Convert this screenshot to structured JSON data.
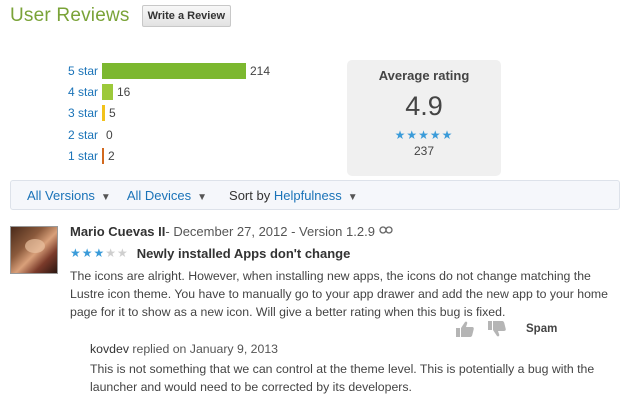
{
  "header": {
    "title": "User Reviews",
    "write_label": "Write a Review"
  },
  "histogram": [
    {
      "label": "5 star",
      "count": "214",
      "value": 214,
      "color": "#7cb82f"
    },
    {
      "label": "4 star",
      "count": "16",
      "value": 16,
      "color": "#9cc93a"
    },
    {
      "label": "3 star",
      "count": "5",
      "value": 5,
      "color": "#f2c21b"
    },
    {
      "label": "2 star",
      "count": "0",
      "value": 0,
      "color": "#f0a020"
    },
    {
      "label": "1 star",
      "count": "2",
      "value": 2,
      "color": "#d2691e"
    }
  ],
  "average": {
    "title": "Average rating",
    "value": "4.9",
    "stars": "★★★★★",
    "count": "237"
  },
  "filters": {
    "versions": "All Versions",
    "devices": "All Devices",
    "sort_prefix": "Sort by",
    "sort_value": "Helpfulness"
  },
  "review": {
    "author": "Mario Cuevas II",
    "meta": " - December 27, 2012 - Version 1.2.9",
    "stars_on": "★★★",
    "stars_off": "★★",
    "title": "Newly installed Apps don't change",
    "text": "The icons are alright. However, when installing new apps, the icons do not change matching the Lustre icon theme. You have to manually go to your app drawer and add the new app to your home page for it to show as a new icon. Will give a better rating when this bug is fixed.",
    "spam_label": "Spam"
  },
  "reply": {
    "author": "kovdev",
    "meta": " replied on January 9, 2013",
    "text": "This is not something that we can control at the theme level. This is potentially a bug with the launcher and would need to be corrected by its developers."
  },
  "colors": {
    "accent": "#7aa338",
    "link": "#1a73b8",
    "star": "#3a9bd9"
  }
}
